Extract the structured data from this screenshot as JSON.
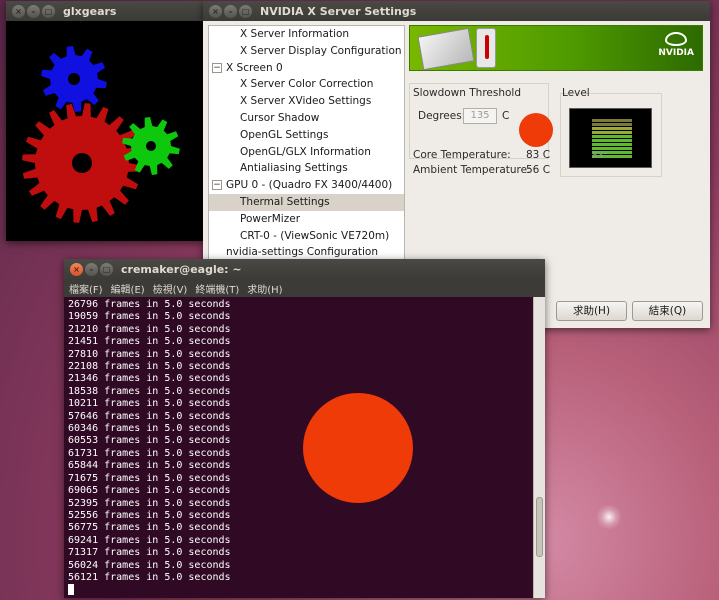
{
  "glxgears": {
    "title": "glxgears",
    "colors": {
      "gear_red": "#c00e0e",
      "gear_green": "#0ec80e",
      "gear_blue": "#1010e0"
    }
  },
  "nvidia": {
    "title": "NVIDIA X Server Settings",
    "logo_text": "NVIDIA",
    "tree": [
      {
        "label": "X Server Information",
        "level": 1,
        "expander": ""
      },
      {
        "label": "X Server Display Configuration",
        "level": 1,
        "expander": ""
      },
      {
        "label": "X Screen 0",
        "level": 0,
        "expander": "−"
      },
      {
        "label": "X Server Color Correction",
        "level": 1,
        "expander": ""
      },
      {
        "label": "X Server XVideo Settings",
        "level": 1,
        "expander": ""
      },
      {
        "label": "Cursor Shadow",
        "level": 1,
        "expander": ""
      },
      {
        "label": "OpenGL Settings",
        "level": 1,
        "expander": ""
      },
      {
        "label": "OpenGL/GLX Information",
        "level": 1,
        "expander": ""
      },
      {
        "label": "Antialiasing Settings",
        "level": 1,
        "expander": ""
      },
      {
        "label": "GPU 0 - (Quadro FX 3400/4400)",
        "level": 0,
        "expander": "−"
      },
      {
        "label": "Thermal Settings",
        "level": 1,
        "expander": "",
        "selected": true
      },
      {
        "label": "PowerMizer",
        "level": 1,
        "expander": ""
      },
      {
        "label": "CRT-0 - (ViewSonic VE720m)",
        "level": 1,
        "expander": ""
      },
      {
        "label": "nvidia-settings Configuration",
        "level": 0,
        "expander": ""
      }
    ],
    "slowdown": {
      "title": "Slowdown Threshold",
      "degrees_label": "Degrees:",
      "degrees_value": "135",
      "unit": "C"
    },
    "level": {
      "title": "Level",
      "gauge_text": "83°"
    },
    "core_temp_label": "Core Temperature:",
    "core_temp_value": "83 C",
    "ambient_temp_label": "Ambient Temperature:",
    "ambient_temp_value": "56 C",
    "help_button": "求助(H)",
    "quit_button": "結束(Q)"
  },
  "terminal": {
    "title": "cremaker@eagle: ~",
    "menu": [
      "檔案(F)",
      "編輯(E)",
      "檢視(V)",
      "終端機(T)",
      "求助(H)"
    ],
    "lines": [
      "26796 frames in 5.0 seconds",
      "19059 frames in 5.0 seconds",
      "21210 frames in 5.0 seconds",
      "21451 frames in 5.0 seconds",
      "27810 frames in 5.0 seconds",
      "22108 frames in 5.0 seconds",
      "21346 frames in 5.0 seconds",
      "18538 frames in 5.0 seconds",
      "10211 frames in 5.0 seconds",
      "57646 frames in 5.0 seconds",
      "60346 frames in 5.0 seconds",
      "60553 frames in 5.0 seconds",
      "61731 frames in 5.0 seconds",
      "65844 frames in 5.0 seconds",
      "71675 frames in 5.0 seconds",
      "69065 frames in 5.0 seconds",
      "52395 frames in 5.0 seconds",
      "52556 frames in 5.0 seconds",
      "56775 frames in 5.0 seconds",
      "69241 frames in 5.0 seconds",
      "71317 frames in 5.0 seconds",
      "56024 frames in 5.0 seconds",
      "56121 frames in 5.0 seconds"
    ]
  },
  "overlay_color": "#ee3b08"
}
